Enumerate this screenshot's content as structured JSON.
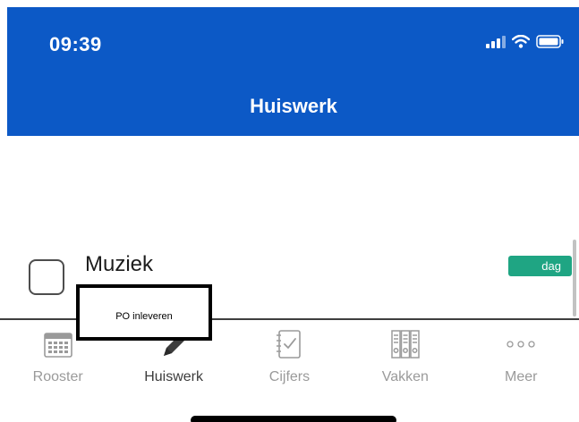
{
  "status_bar": {
    "time": "09:39",
    "icons": [
      "signal-icon",
      "wifi-icon",
      "battery-icon"
    ]
  },
  "header": {
    "title": "Huiswerk"
  },
  "task": {
    "checked": false,
    "subject": "Muziek",
    "badge": "dag"
  },
  "tooltip": {
    "text": "PO inleveren"
  },
  "tabbar": {
    "active": "Huiswerk",
    "tabs": [
      {
        "label": "Rooster",
        "icon": "calendar-icon"
      },
      {
        "label": "Huiswerk",
        "icon": "pencil-icon"
      },
      {
        "label": "Cijfers",
        "icon": "checklist-icon"
      },
      {
        "label": "Vakken",
        "icon": "binders-icon"
      },
      {
        "label": "Meer",
        "icon": "more-dots-icon"
      }
    ]
  },
  "colors": {
    "header_bg": "#0c59c6",
    "badge_bg": "#1fa583",
    "tab_inactive": "#9a9a9a",
    "tab_active": "#3c3c3c"
  }
}
